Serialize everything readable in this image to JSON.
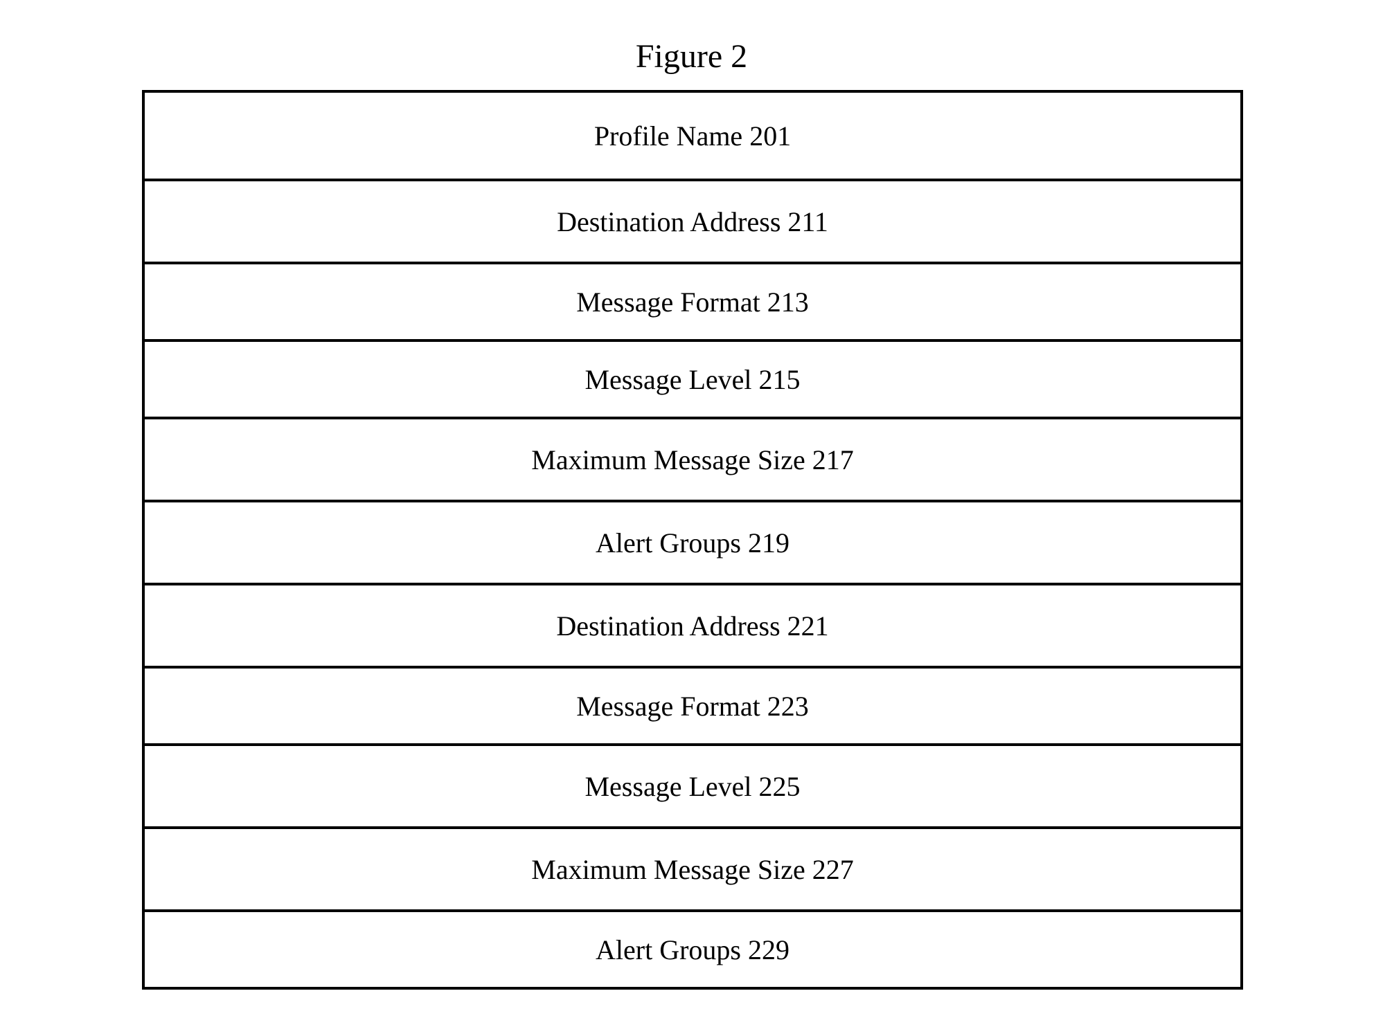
{
  "figure_title": "Figure 2",
  "rows": [
    {
      "label": "Profile Name 201"
    },
    {
      "label": "Destination Address 211"
    },
    {
      "label": "Message Format 213"
    },
    {
      "label": "Message Level 215"
    },
    {
      "label": "Maximum Message Size 217"
    },
    {
      "label": "Alert Groups 219"
    },
    {
      "label": "Destination Address 221"
    },
    {
      "label": "Message Format 223"
    },
    {
      "label": "Message Level 225"
    },
    {
      "label": "Maximum Message Size 227"
    },
    {
      "label": "Alert Groups 229"
    }
  ]
}
